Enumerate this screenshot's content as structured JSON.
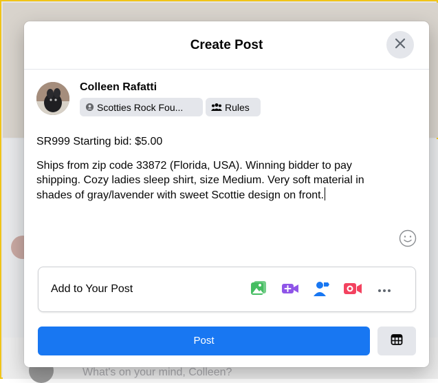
{
  "dialog": {
    "title": "Create Post",
    "close_icon": "close-icon"
  },
  "author": {
    "name": "Colleen Rafatti",
    "audience_label": "Scotties Rock Fou...",
    "audience_icon": "globe-group-icon",
    "rules_label": "Rules",
    "rules_icon": "people-icon"
  },
  "post": {
    "line1": "SR999  Starting bid: $5.00",
    "body": "Ships from zip code 33872 (Florida, USA).  Winning bidder to pay shipping.  Cozy ladies sleep shirt, size Medium.  Very soft material in shades of gray/lavender with sweet Scottie design on front."
  },
  "add_to_post": {
    "label": "Add to Your Post",
    "icons": [
      "photo-video-icon",
      "room-video-icon",
      "tag-people-icon",
      "live-video-icon",
      "more-icon"
    ]
  },
  "actions": {
    "post_label": "Post",
    "schedule_icon": "calendar-grid-icon"
  },
  "background": {
    "prompt": "What's on your mind, Colleen?"
  },
  "colors": {
    "primary": "#1877f2",
    "photo_green": "#45bd62",
    "room_purple": "#8f55e8",
    "tag_blue": "#1877f2",
    "live_red": "#f3425f"
  }
}
